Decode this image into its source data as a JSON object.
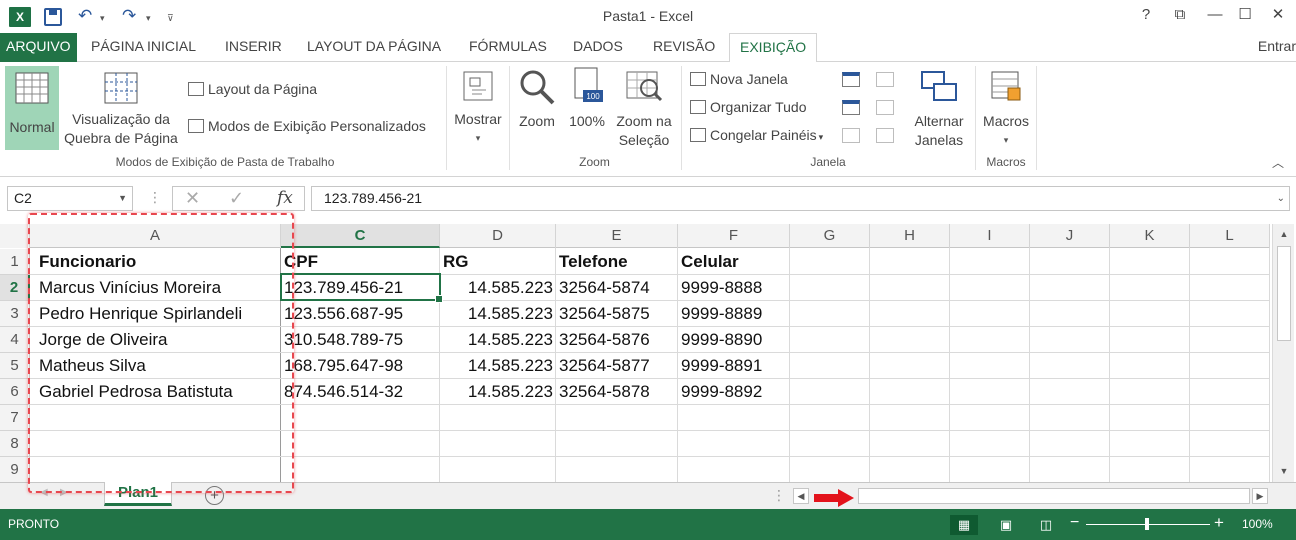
{
  "window": {
    "title": "Pasta1 - Excel",
    "controls": [
      "?",
      "⧉",
      "—",
      "☐",
      "✕"
    ]
  },
  "ribbon_tabs": [
    {
      "label": "ARQUIVO"
    },
    {
      "label": "PÁGINA INICIAL"
    },
    {
      "label": "INSERIR"
    },
    {
      "label": "LAYOUT DA PÁGINA"
    },
    {
      "label": "FÓRMULAS"
    },
    {
      "label": "DADOS"
    },
    {
      "label": "REVISÃO"
    },
    {
      "label": "EXIBIÇÃO"
    }
  ],
  "signin": "Entrar",
  "ribbon": {
    "workbook_views": {
      "normal": "Normal",
      "page_break_line1": "Visualização da",
      "page_break_line2": "Quebra de Página",
      "page_layout": "Layout da Página",
      "custom_views": "Modos de Exibição Personalizados",
      "group_label": "Modos de Exibição de Pasta de Trabalho"
    },
    "show": {
      "label": "Mostrar"
    },
    "zoom": {
      "zoom": "Zoom",
      "hundred": "100%",
      "hundred_icon_text": "100",
      "selection_line1": "Zoom na",
      "selection_line2": "Seleção",
      "group_label": "Zoom"
    },
    "window": {
      "new_window": "Nova Janela",
      "arrange_all": "Organizar Tudo",
      "freeze_panes": "Congelar Painéis",
      "switch_line1": "Alternar",
      "switch_line2": "Janelas",
      "group_label": "Janela"
    },
    "macros": {
      "label": "Macros",
      "group_label": "Macros"
    }
  },
  "formula_bar": {
    "name_box": "C2",
    "formula": "123.789.456-21",
    "fx": "fx"
  },
  "sheet": {
    "columns": [
      "A",
      "C",
      "D",
      "E",
      "F",
      "G",
      "H",
      "I",
      "J",
      "K",
      "L"
    ],
    "rows": [
      "1",
      "2",
      "3",
      "4",
      "5",
      "6",
      "7",
      "8",
      "9"
    ],
    "header_row": [
      "Funcionario",
      "CPF",
      "RG",
      "Telefone",
      "Celular"
    ],
    "data": [
      [
        "Marcus Vinícius Moreira",
        "123.789.456-21",
        "14.585.223",
        "32564-5874",
        "9999-8888"
      ],
      [
        "Pedro Henrique Spirlandeli",
        "123.556.687-95",
        "14.585.223",
        "32564-5875",
        "9999-8889"
      ],
      [
        "Jorge de Oliveira",
        "310.548.789-75",
        "14.585.223",
        "32564-5876",
        "9999-8890"
      ],
      [
        "Matheus Silva",
        "168.795.647-98",
        "14.585.223",
        "32564-5877",
        "9999-8891"
      ],
      [
        "Gabriel Pedrosa Batistuta",
        "874.546.514-32",
        "14.585.223",
        "32564-5878",
        "9999-8892"
      ]
    ],
    "tab_name": "Plan1"
  },
  "status": {
    "text": "PRONTO",
    "zoom": "100%"
  },
  "colors": {
    "excel_green": "#217346",
    "annotation_red": "#e8474f",
    "arrow_red": "#e3131b"
  }
}
